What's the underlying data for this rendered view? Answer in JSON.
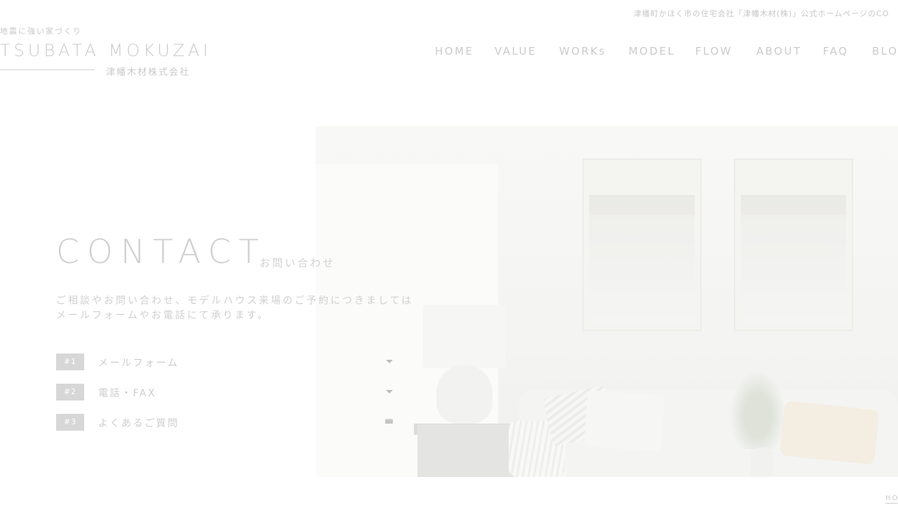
{
  "top_note": "津幡町かほく市の住宅会社「津幡木材(株)」公式ホームページのCO",
  "logo": {
    "tagline": "地震に強い家づくり",
    "name": "TSUBATA MOKUZAI",
    "name_jp": "津幡木材株式会社"
  },
  "nav": {
    "items": [
      {
        "label": "HOME"
      },
      {
        "label": "VALUE"
      },
      {
        "label": "WORKs"
      },
      {
        "label": "MODEL"
      },
      {
        "label": "FLOW"
      },
      {
        "label": "ABOUT"
      },
      {
        "label": "FAQ"
      },
      {
        "label": "BLOG"
      }
    ]
  },
  "contact": {
    "title": "CONTACT",
    "subtitle": "お問い合わせ",
    "lead_line1": "ご相談やお問い合わせ、モデルハウス来場のご予約につきましては",
    "lead_line2": "メールフォームやお電話にて承ります。"
  },
  "menu": [
    {
      "badge": "#1",
      "label": "メールフォーム",
      "icon": "chevron-down-icon"
    },
    {
      "badge": "#2",
      "label": "電話・FAX",
      "icon": "chevron-down-icon"
    },
    {
      "badge": "#3",
      "label": "よくあるご質問",
      "icon": "book-icon"
    }
  ],
  "breadcrumb_home": "HO",
  "colors": {
    "text": "#c9c9c9",
    "badge": "#d7d7d7",
    "background": "#ffffff"
  }
}
